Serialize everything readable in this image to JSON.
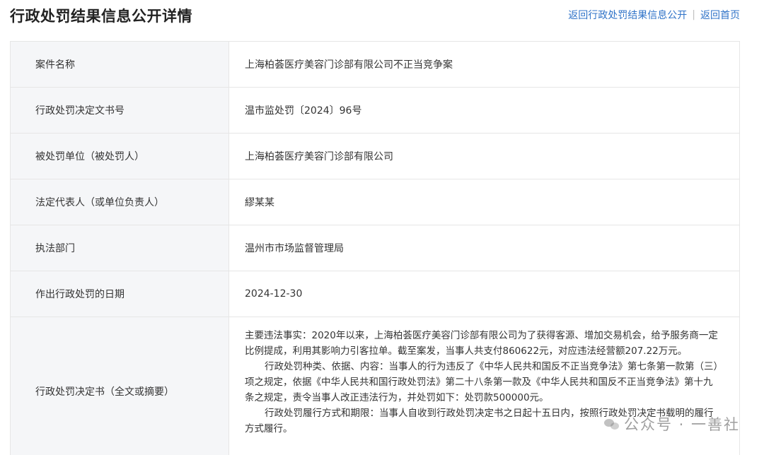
{
  "header": {
    "title": "行政处罚结果信息公开详情",
    "link_back_list": "返回行政处罚结果信息公开",
    "separator": "|",
    "link_home": "返回首页"
  },
  "rows": [
    {
      "label": "案件名称",
      "value": "上海柏荟医疗美容门诊部有限公司不正当竞争案"
    },
    {
      "label": "行政处罚决定文书号",
      "value": "温市监处罚〔2024〕96号"
    },
    {
      "label": "被处罚单位（被处罚人）",
      "value": "上海柏荟医疗美容门诊部有限公司"
    },
    {
      "label": "法定代表人（或单位负责人）",
      "value": "繆某某"
    },
    {
      "label": "执法部门",
      "value": "温州市市场监督管理局"
    },
    {
      "label": "作出行政处罚的日期",
      "value": "2024-12-30"
    }
  ],
  "decision": {
    "label": "行政处罚决定书（全文或摘要）",
    "paragraphs": [
      "主要违法事实：2020年以来，上海柏荟医疗美容门诊部有限公司为了获得客源、增加交易机会，给予服务商一定比例提成，利用其影响力引客拉单。截至案发，当事人共支付860622元，对应违法经营额207.22万元。",
      "行政处罚种类、依据、内容：当事人的行为违反了《中华人民共和国反不正当竞争法》第七条第一款第（三）项之规定，依据《中华人民共和国行政处罚法》第二十八条第一款及《中华人民共和国反不正当竞争法》第十九条之规定，责令当事人改正违法行为，并处罚如下：处罚款500000元。",
      "行政处罚履行方式和期限：当事人自收到行政处罚决定书之日起十五日内，按照行政处罚决定书载明的履行方式履行。"
    ]
  },
  "watermark": {
    "text": "公众号 · 一善社"
  }
}
